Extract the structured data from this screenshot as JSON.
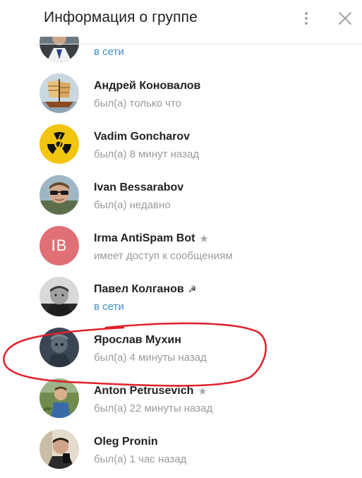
{
  "header": {
    "title": "Информация о группе",
    "menu_icon": "more-vertical-icon",
    "close_icon": "close-icon"
  },
  "members": [
    {
      "name": "",
      "status": "в сети",
      "online": true,
      "avatar": "photo"
    },
    {
      "name": "Андрей Коновалов",
      "status": "был(а) только что",
      "online": false,
      "avatar": "photo-ship"
    },
    {
      "name": "Vadim Goncharov",
      "status": "был(а) 8 минут назад",
      "online": false,
      "avatar": "radiation-symbol"
    },
    {
      "name": "Ivan Bessarabov",
      "status": "был(а) недавно",
      "online": false,
      "avatar": "photo-sunglasses"
    },
    {
      "name": "Irma AntiSpam Bot",
      "status": "имеет доступ к сообщениям",
      "online": false,
      "avatar": "initials",
      "initials": "IB",
      "avatar_color": "#e17076",
      "badge": "star-icon"
    },
    {
      "name": "Павел Колганов",
      "status": "в сети",
      "online": true,
      "avatar": "photo-bw",
      "badge": "hammer-sickle-icon"
    },
    {
      "name": "Ярослав Мухин",
      "status": "был(а) 4 минуты назад",
      "online": false,
      "avatar": "photo-dark",
      "highlighted": true
    },
    {
      "name": "Anton Petrusevich",
      "status": "был(а) 22 минуты назад",
      "online": false,
      "avatar": "photo-outdoor",
      "badge": "star-icon"
    },
    {
      "name": "Oleg Pronin",
      "status": "был(а) 1 час назад",
      "online": false,
      "avatar": "photo-selfie"
    }
  ],
  "colors": {
    "online": "#3a8fc7",
    "annotation": "#e0202a"
  }
}
